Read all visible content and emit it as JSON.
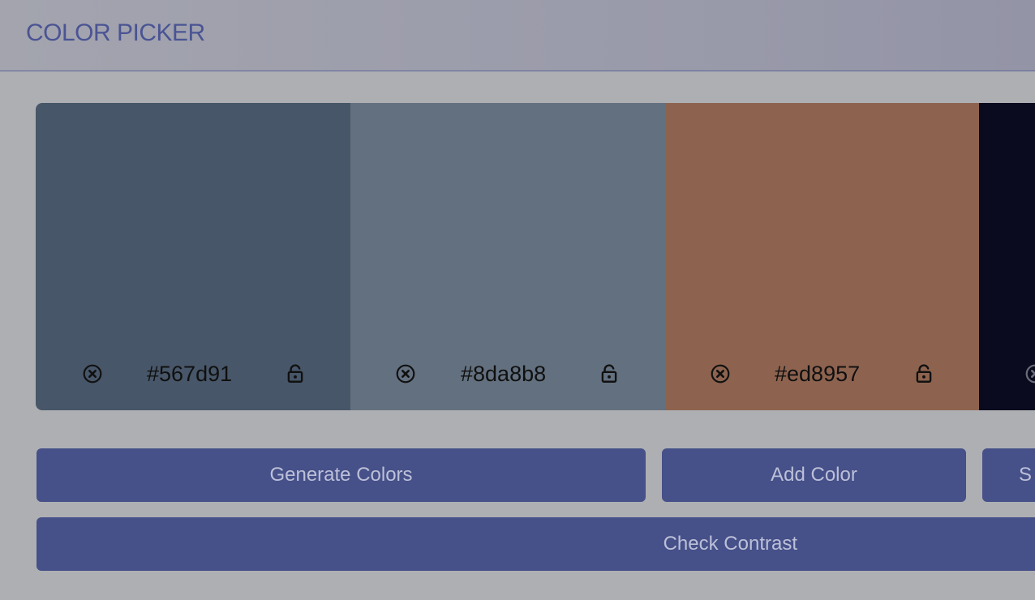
{
  "header": {
    "title": "COLOR PICKER"
  },
  "swatches": [
    {
      "hex": "#567d91",
      "display_color": "#475668",
      "remove_icon": "circle-x-icon",
      "lock_icon": "unlocked-padlock-icon"
    },
    {
      "hex": "#8da8b8",
      "display_color": "#63707f",
      "remove_icon": "circle-x-icon",
      "lock_icon": "unlocked-padlock-icon"
    },
    {
      "hex": "#ed8957",
      "display_color": "#8d634f",
      "remove_icon": "circle-x-icon",
      "lock_icon": "unlocked-padlock-icon"
    },
    {
      "hex": "",
      "display_color": "#0b0b1f",
      "remove_icon": "circle-x-icon",
      "lock_icon": ""
    }
  ],
  "actions": {
    "generate_label": "Generate Colors",
    "add_label": "Add Color",
    "save_label": "S",
    "contrast_label": "Check Contrast"
  },
  "colors": {
    "page_background": "#aeafb3",
    "accent": "#465089",
    "accent_text": "#bcc0d8",
    "title_color": "#4a5494"
  }
}
